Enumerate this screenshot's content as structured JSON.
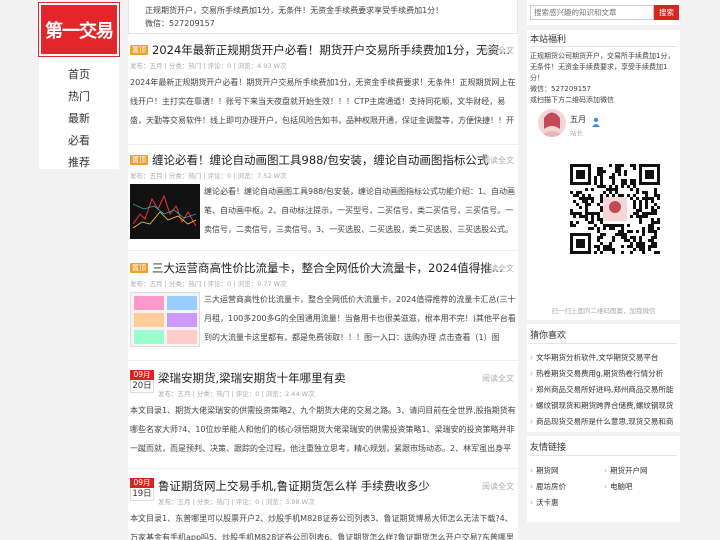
{
  "logo": {
    "text": "第一交易"
  },
  "nav": [
    "首页",
    "热门",
    "最新",
    "必看",
    "推荐"
  ],
  "topbox": {
    "line1": "正规期货开户，交易所手续费加1分，无条件！无资金手续费要求享受手续费加1分！",
    "line2": "微信：527209157"
  },
  "articles": [
    {
      "tag": "置顶",
      "title": "2024年最新正规期货开户必看！期货开户交易所手续费加1分，无资...",
      "readmore": "阅读全文",
      "meta": "发布：五月 | 分类：热门 | 评论：0 | 浏览：4.93 W次",
      "excerpt": "2024年最新正规期货开户必看！期货开户交易所手续费加1分，无资金手续费要求！无条件！正规期货网上在线开户！主打实在靠谱！！账号下来当天夜盘就开始生效！！！CTP主席通道！支持同花顺，文华财经，易盛，天勤等交易软件！线上即可办理开户，包括风险告知书，品种权限开通，保证金调整等，方便快捷！！开"
    },
    {
      "tag": "置顶",
      "title": "缠论必看！缠论自动画图工具988/包安装，缠论自动画图指标公式",
      "readmore": "阅读全文",
      "meta": "发布：五月 | 分类：热门 | 评论：0 | 浏览：7.52 W次",
      "excerpt": "缠论必看！缠论自动画图工具988/包安装，缠论自动画图指标公式功能介绍：1、自动画笔、自动画中枢。2、自动标注提示，一买型号，二买信号，类二买信号，三买信号。一卖信号，二卖信号，三卖信号。3、一买选股、二买选股，类二买选股、三买选股公式。"
    },
    {
      "tag": "置顶",
      "title": "三大运营商高性价比流量卡，整合全网低价大流量卡，2024值得推...",
      "readmore": "阅读全文",
      "meta": "发布：五月 | 分类：热门 | 评论：0 | 浏览：9.77 W次",
      "excerpt": "三大运营商高性价比流量卡，整合全网低价大流量卡，2024值得推荐的流量卡汇总(三十月租，100多200多G的全国通用流量！当备用卡也很美滋滋，根本用不完！)其他平台看到的大流量卡这里都有，都是免费领取！！！图一入口：选购办理 点击查看（1）图"
    },
    {
      "month": "09月",
      "day": "20日",
      "title": "梁瑞安期货,梁瑞安期货十年哪里有卖",
      "readmore": "阅读全文",
      "meta": "发布：五月 | 分类：热门 | 评论：0 | 浏览：2.44 W次",
      "excerpt": "本文目录1、期货大佬梁瑞安的供需投资策略2、九个期货大佬的交易之路。3、请问目前在全世界,股指期货有哪些名家大师?4、10位炒单能人和他们的核心领悟期货大佬梁瑞安的供需投资策略1、梁瑞安的投资策略并非一蹴而就，而是预判、决策、跟踪的全过程，他注重独立思考，精心规划，紧跟市场动态。2、林军虽出身平"
    },
    {
      "month": "09月",
      "day": "19日",
      "title": "鲁证期货网上交易手机,鲁证期货怎么样 手续费收多少",
      "readmore": "阅读全文",
      "meta": "发布：五月 | 分类：热门 | 评论：0 | 浏览：3.98 W次",
      "excerpt": "本文目录1、东普哪里可以股票开户2、炒股手机M828证券公司列表3、鲁证期货博易大师怎么无法下载?4、万家基金有手机app吗5、炒股手机M828证券公司列表6、鲁证期货怎么样?鲁证期货怎么开户交易?东普哪里可"
    }
  ],
  "sidebar": {
    "search_placeholder": "搜索感兴趣的知识和文章",
    "search_button": "搜索",
    "welfare_title": "本站福利",
    "welfare_text": "正规期货公司期货开户，交易所手续费加1分，无条件！无资金手续费要求，享受手续费加1分！",
    "welfare_wechat": "微信：527209157",
    "welfare_qr_note": "或扫描下方二维码添加微信",
    "author_name": "五月",
    "author_role": "站长",
    "qr_caption": "扫一扫上面的二维码图案，加我微信",
    "guess_title": "猜你喜欢",
    "guess_items": [
      "文华期货分析软件,文华期货交易平台",
      "热卷期货交易费用g,期货热卷行情分析",
      "郑州商品交易所好进吗,郑州商品交易所能",
      "螺纹钢现货和期货跨界合储费,螺纹钢现货",
      "商品现货交易所是什么意思,现货交易和商"
    ],
    "links_title": "友情链接",
    "links": [
      "期货网",
      "期货开户网",
      "鹿坊房价",
      "电脑吧",
      "沃卡惠"
    ]
  }
}
